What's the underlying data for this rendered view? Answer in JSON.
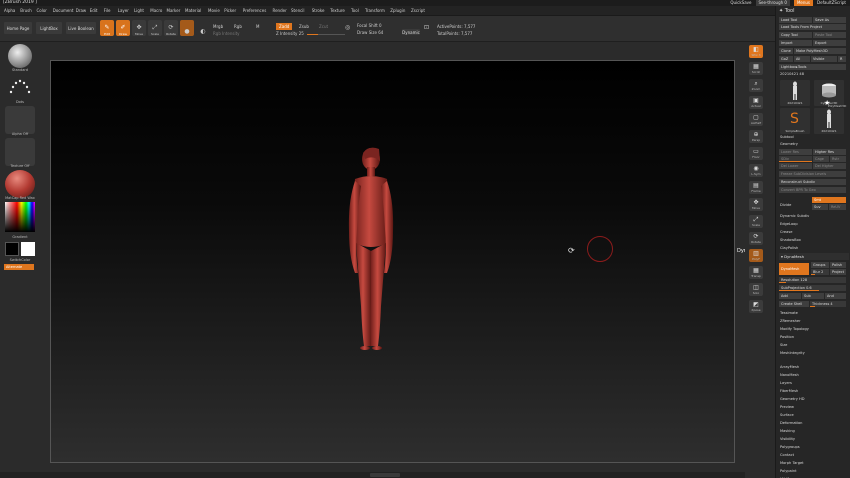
{
  "window": {
    "title": "[ZBrush 2019 ]",
    "quicksave": "QuickSave",
    "seethrough": "See-through  0",
    "menus": "Menus",
    "default_script": "DefaultZScript"
  },
  "menubar": [
    "Alpha",
    "Brush",
    "Color",
    "Document",
    "Draw",
    "Edit",
    "File",
    "Layer",
    "Light",
    "Macro",
    "Marker",
    "Material",
    "Movie",
    "Picker",
    "Preferences",
    "Render",
    "Stencil",
    "Stroke",
    "Texture",
    "Tool",
    "Transform",
    "Zplugin",
    "Zscript"
  ],
  "toolbar": {
    "home_page": "Home Page",
    "lightbox": "LightBox",
    "live_boolean": "Live Boolean",
    "edit": "Edit",
    "draw": "Draw",
    "move": "Move",
    "scale": "Scale",
    "rotate": "Rotate",
    "mrgb": "Mrgb",
    "rgb": "Rgb",
    "m": "M",
    "zadd": "Zadd",
    "zsub": "Zsub",
    "zcut": "Zcut",
    "rgb_intensity": "Rgb Intensity",
    "z_intensity": "Z Intensity  25",
    "focal_shift": "Focal Shift  0",
    "draw_size": "Draw Size  64",
    "dynamic": "Dynamic",
    "active_points": "ActivePoints: 7,577",
    "total_points": "TotalPoints: 7,577"
  },
  "left_shelf": {
    "brush": "Standard",
    "stroke": "Dots",
    "alpha": "Alpha Off",
    "texture": "Texture Off",
    "material": "MatCap Red Wax",
    "gradient": "Gradient",
    "switch_color": "SwitchColor",
    "alternate": "Alternate"
  },
  "right_shelf": [
    {
      "icon": "◧",
      "label": "SPix 3"
    },
    {
      "icon": "▦",
      "label": "Scroll"
    },
    {
      "icon": "⌕",
      "label": "Zoom"
    },
    {
      "icon": "▣",
      "label": "Actual"
    },
    {
      "icon": "▢",
      "label": "AAHalf"
    },
    {
      "icon": "⊕",
      "label": "Persp"
    },
    {
      "icon": "▭",
      "label": "Floor"
    },
    {
      "icon": "◉",
      "label": "L.Sym"
    },
    {
      "icon": "▤",
      "label": "Frame"
    },
    {
      "icon": "✥",
      "label": "Move"
    },
    {
      "icon": "⤢",
      "label": "Scale"
    },
    {
      "icon": "⟳",
      "label": "Rotate"
    },
    {
      "icon": "▥",
      "label": "PolyF"
    },
    {
      "icon": "▦",
      "label": "Transp"
    },
    {
      "icon": "◫",
      "label": "Solo"
    },
    {
      "icon": "◩",
      "label": "Xpose"
    }
  ],
  "canvas": {
    "tooltip": "DynaMesh"
  },
  "tool_palette": {
    "title": "Tool",
    "load_tool": "Load Tool",
    "save_as": "Save As",
    "load_tools_from_project": "Load Tools From Project",
    "copy_tool": "Copy Tool",
    "paste_tool": "Paste Tool",
    "import": "Import",
    "export": "Export",
    "clone": "Clone",
    "make_polymesh": "Make PolyMesh3D",
    "goz": "GoZ",
    "all": "All",
    "visible": "Visible",
    "r": "R",
    "lightbox_tools": "Lightbox▸Tools",
    "current_tool": "20210421  48",
    "thumbs": [
      "20210421",
      "Cylinder3D",
      "SimpleBrush",
      "20210421"
    ],
    "thumb2_alt": "PolyMesh3D",
    "subtool": "Subtool",
    "geometry": "Geometry",
    "lower_res": "Lower Res",
    "higher_res": "Higher Res",
    "sdiv": "SDiv",
    "cage": "Cage",
    "rstr": "Rstr",
    "del_lower": "Del Lower",
    "del_higher": "Del Higher",
    "freeze_subdiv": "Freeze SubDivision Levels",
    "reconstruct_subdiv": "Reconstruct Subdiv",
    "convert_bpr": "Convert BPR To Geo",
    "divide": "Divide",
    "smt": "Smt",
    "suv": "Suv",
    "reuv": "ReUV",
    "dynamic_subdiv": "Dynamic Subdiv",
    "edgeloop": "EdgeLoop",
    "crease": "Crease",
    "shadowbox": "ShadowBox",
    "claypolish": "ClayPolish",
    "dynamesh_header": "DynaMesh",
    "dynamesh_btn": "DynaMesh",
    "groups": "Groups",
    "polish": "Polish",
    "blur": "Blur  2",
    "project": "Project",
    "resolution": "Resolution  128",
    "subprojection": "SubProjection  0.6",
    "add": "Add",
    "sub": "Sub",
    "and": "And",
    "create_shell": "Create Shell",
    "thickness": "Thickness  4",
    "tessimate": "Tessimate",
    "zremesher": "ZRemesher",
    "modify_topology": "Modify Topology",
    "position": "Position",
    "size": "Size",
    "mesh_integrity": "MeshIntegrity",
    "sections": [
      "ArrayMesh",
      "NanoMesh",
      "Layers",
      "FiberMesh",
      "Geometry HD",
      "Preview",
      "Surface",
      "Deformation",
      "Masking",
      "Visibility",
      "Polygroups",
      "Contact",
      "Morph Target",
      "Polypaint",
      "UV Map"
    ]
  },
  "colors": {
    "accent": "#e0761e",
    "model": "#b23a32",
    "background": "#2b2b2b"
  }
}
